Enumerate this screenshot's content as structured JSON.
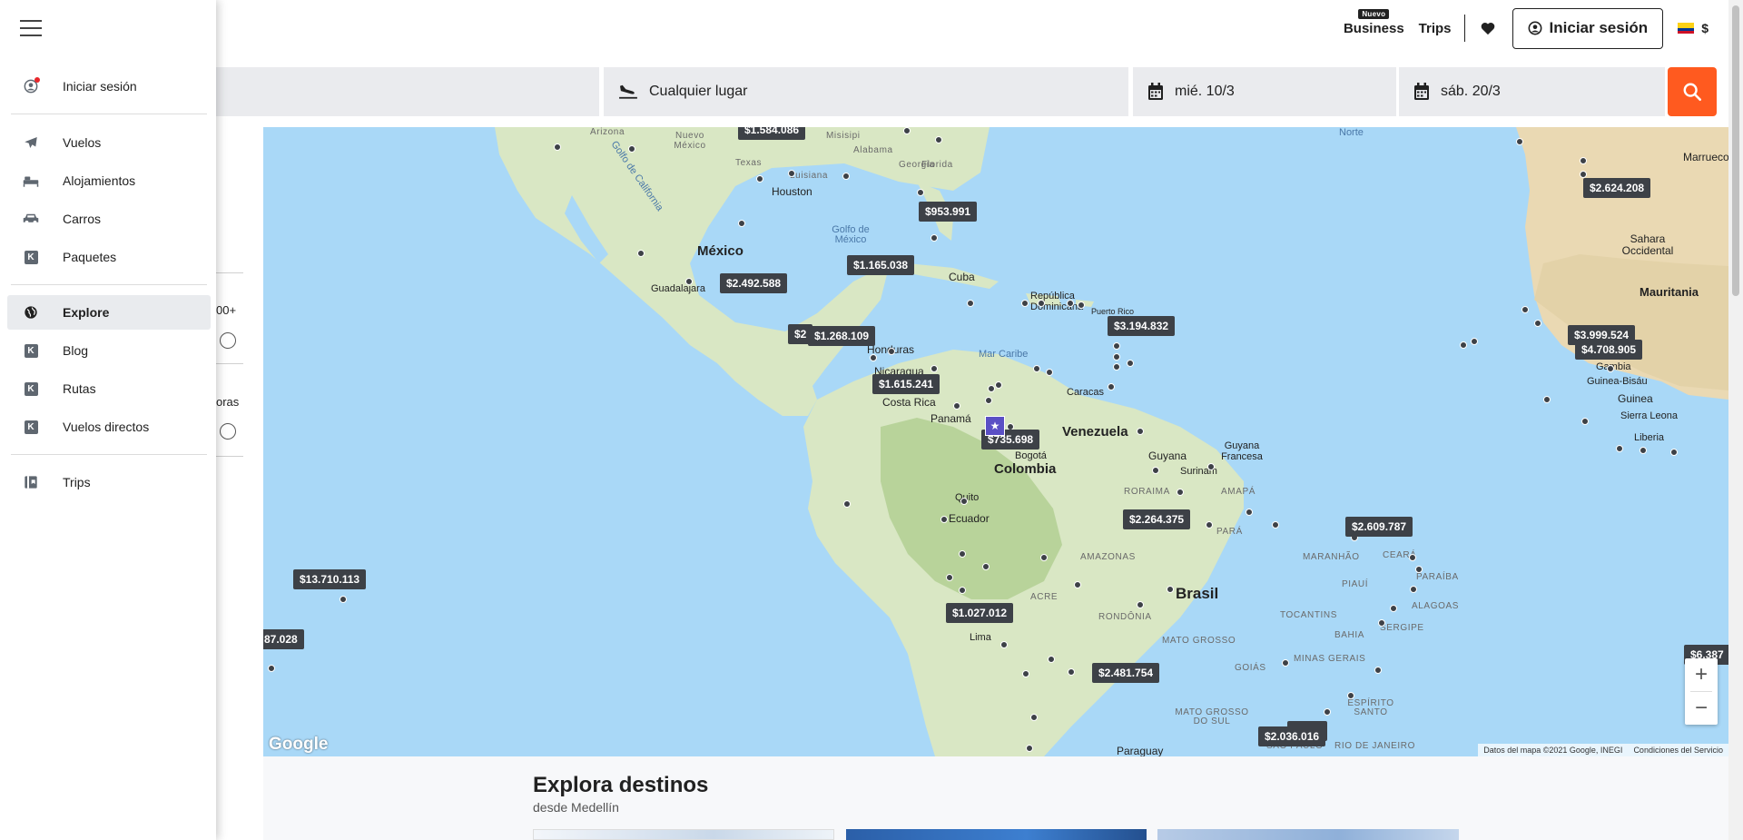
{
  "header": {
    "business_label": "Business",
    "business_badge": "Nuevo",
    "trips_label": "Trips",
    "signin_label": "Iniciar sesión",
    "currency": "$",
    "flag_colors": [
      "#fcd116",
      "#003893",
      "#ce1126"
    ]
  },
  "search": {
    "origin": "",
    "destination_placeholder": "Cualquier lugar",
    "depart_date": "mié. 10/3",
    "return_date": "sáb. 20/3",
    "button_color": "#ff5a1f"
  },
  "filters": {
    "partial_label_1": "00+",
    "partial_label_2": "oras"
  },
  "drawer": {
    "signin_label": "Iniciar sesión",
    "items_primary": [
      "Vuelos",
      "Alojamientos",
      "Carros",
      "Paquetes"
    ],
    "items_explore": [
      "Explore",
      "Blog",
      "Rutas",
      "Vuelos directos"
    ],
    "trips_label": "Trips",
    "k_letter": "K"
  },
  "map": {
    "water_labels": [
      "Golfo de California",
      "Golfo de México",
      "Mar Caribe",
      "Norte"
    ],
    "country_labels": [
      "México",
      "Colombia",
      "Venezuela",
      "Brasil",
      "Mauritania",
      "Sahara Occidental",
      "Cuba",
      "República Dominicana",
      "Puerto Rico",
      "Honduras",
      "Nicaragua",
      "Costa Rica",
      "Panamá",
      "Guyana",
      "Surinam",
      "Guyana Francesa",
      "Ecuador",
      "Paraguay",
      "Guinea",
      "Guinea-Bisáu",
      "Gambia",
      "Sierra Leona",
      "Liberia",
      "Marruecos"
    ],
    "city_labels": [
      "Houston",
      "Guadalajara",
      "Bogotá",
      "Caracas",
      "Quito",
      "Lima",
      "Texas",
      "Alabama",
      "Georgia",
      "Luisiana",
      "Misisipi",
      "Florida",
      "Nuevo México",
      "Arizona"
    ],
    "region_labels": [
      "RORAIMA",
      "AMAPÁ",
      "AMAZONAS",
      "PARÁ",
      "MARANHÃO",
      "CEARÁ",
      "PIAUÍ",
      "PARAÍBA",
      "ALAGOAS",
      "ACRE",
      "RONDÔNIA",
      "TOCANTINS",
      "SERGIPE",
      "BAHIA",
      "MATO GROSSO",
      "GOIÁS",
      "MINAS GERAIS",
      "ESPÍRITO SANTO",
      "MATO GROSSO DO SUL",
      "SÃO PAULO",
      "RIO DE JANEIRO"
    ],
    "prices": [
      "$1.584.086",
      "$953.991",
      "$1.165.038",
      "$2.492.588",
      "$2",
      "$1.268.109",
      "$1.615.241",
      "$735.698",
      "$3.194.832",
      "$2.264.375",
      "$2.609.787",
      "$13.710.113",
      "87.028",
      "$1.027.012",
      "$2.481.754",
      "6.741",
      "$2.036.016",
      "$2.624.208",
      "$3.999.524",
      "$4.708.905",
      "$6.387"
    ],
    "attribution": "Datos del mapa ©2021 Google, INEGI",
    "terms": "Condiciones del Servicio",
    "google_logo": "Google",
    "zoom_in": "+",
    "zoom_out": "−",
    "origin_marker": "★",
    "water_color": "#a9d8f7",
    "land_color": "#d9e7c4"
  },
  "explora": {
    "title": "Explora destinos",
    "subtitle": "desde Medellín"
  }
}
